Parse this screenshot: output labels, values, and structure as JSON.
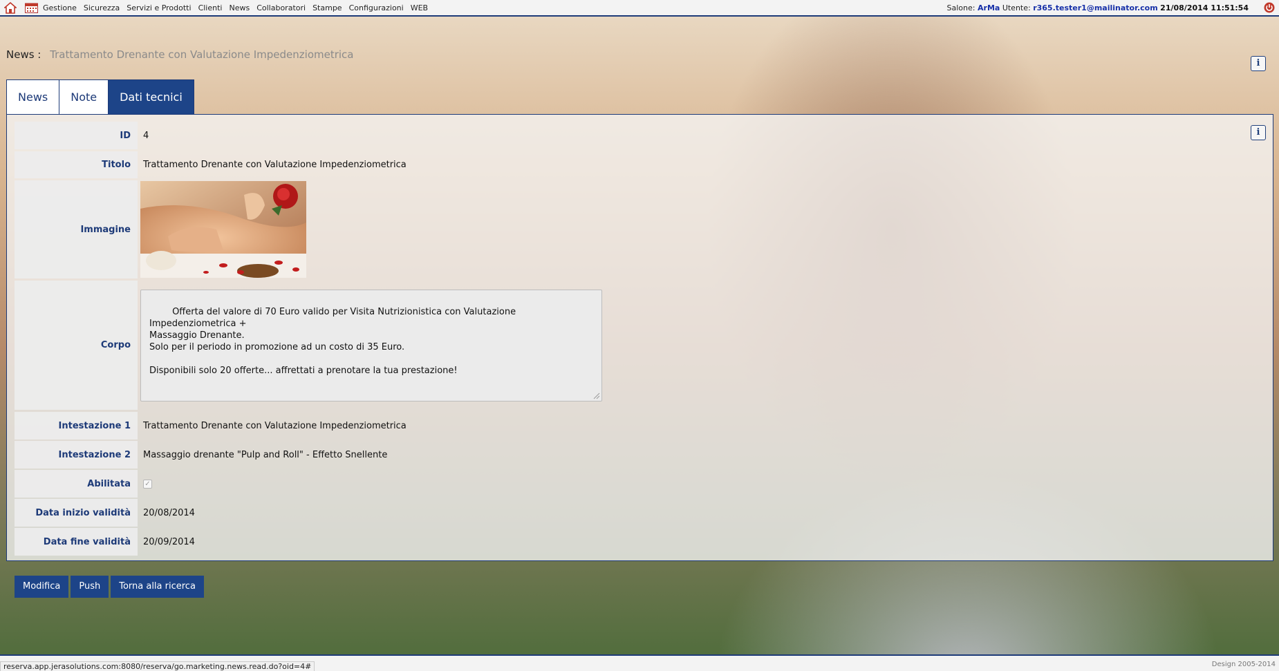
{
  "menu": [
    "Gestione",
    "Sicurezza",
    "Servizi e Prodotti",
    "Clienti",
    "News",
    "Collaboratori",
    "Stampe",
    "Configurazioni",
    "WEB"
  ],
  "user": {
    "salone_label": "Salone:",
    "salone": "ArMa",
    "utente_label": "Utente:",
    "utente": "r365.tester1@mailinator.com",
    "datetime": "21/08/2014  11:51:54"
  },
  "header": {
    "label": "News :",
    "title": "Trattamento Drenante con Valutazione Impedenziometrica"
  },
  "tabs": [
    {
      "label": "News",
      "active": false
    },
    {
      "label": "Note",
      "active": false
    },
    {
      "label": "Dati tecnici",
      "active": true
    }
  ],
  "fields": {
    "id": {
      "label": "ID",
      "value": "4"
    },
    "titolo": {
      "label": "Titolo",
      "value": "Trattamento Drenante con Valutazione Impedenziometrica"
    },
    "immagine": {
      "label": "Immagine"
    },
    "corpo": {
      "label": "Corpo",
      "value": "Offerta del valore di 70 Euro valido per Visita Nutrizionistica con Valutazione Impedenziometrica +\nMassaggio Drenante.\nSolo per il periodo in promozione ad un costo di 35 Euro.\n\nDisponibili solo 20 offerte... affrettati a prenotare la tua prestazione!"
    },
    "intestazione1": {
      "label": "Intestazione 1",
      "value": "Trattamento Drenante con Valutazione Impedenziometrica"
    },
    "intestazione2": {
      "label": "Intestazione 2",
      "value": "Massaggio drenante \"Pulp and Roll\" - Effetto Snellente"
    },
    "abilitata": {
      "label": "Abilitata",
      "checked": true
    },
    "data_inizio": {
      "label": "Data inizio validità",
      "value": "20/08/2014"
    },
    "data_fine": {
      "label": "Data fine validità",
      "value": "20/09/2014"
    }
  },
  "actions": {
    "modifica": "Modifica",
    "push": "Push",
    "torna": "Torna alla ricerca"
  },
  "footer": {
    "url": "reserva.app.jerasolutions.com:8080/reserva/go.marketing.news.read.do?oid=4#",
    "design": "Design 2005-2014"
  },
  "icons": [
    "home-icon",
    "calendar-icon",
    "power-icon",
    "info-icon",
    "checkbox-check-icon",
    "resize-grip-icon"
  ],
  "colors": {
    "accent": "#1d4488",
    "label": "#1d3a78",
    "user": "#1730a8",
    "power": "#c0392b"
  }
}
